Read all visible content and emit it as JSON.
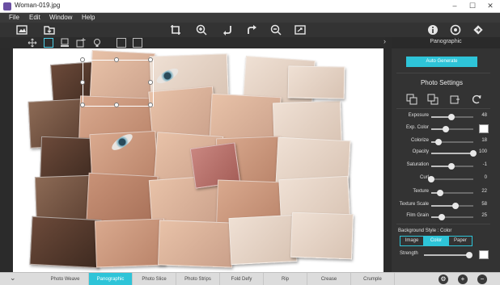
{
  "window": {
    "title": "Woman-019.jpg",
    "minimize": "–",
    "maximize": "☐",
    "close": "✕"
  },
  "menu": [
    "File",
    "Edit",
    "Window",
    "Help"
  ],
  "toolbar": {
    "icons": [
      "image-icon",
      "open-icon",
      "crop-icon",
      "zoom-in-icon",
      "rotate-left-icon",
      "rotate-right-icon",
      "zoom-out-icon",
      "fit-icon",
      "info-icon",
      "settings-icon",
      "share-icon"
    ]
  },
  "toolbar2": {
    "icons": [
      "move-icon",
      "select-icon",
      "stamp-icon",
      "add-tile-icon",
      "light-icon",
      "image-thumb-icon",
      "settings-small-icon"
    ]
  },
  "panel": {
    "header": "Panographic",
    "collapse_glyph": "›",
    "auto_generate": "Auto Generate",
    "section_title": "Photo Settings",
    "controls": [
      {
        "label": "Exposure",
        "value": "48",
        "fraction": 0.48
      },
      {
        "label": "Exp. Color",
        "swatch": "#ffffff",
        "fraction": 0.35
      },
      {
        "label": "Colorize",
        "value": "18",
        "fraction": 0.18
      },
      {
        "label": "Opacity",
        "value": "100",
        "fraction": 1.0
      },
      {
        "label": "Saturation",
        "value": "-1",
        "fraction": 0.49
      },
      {
        "label": "Curl",
        "value": "0",
        "fraction": 0.0
      },
      {
        "label": "Texture",
        "value": "22",
        "fraction": 0.22
      },
      {
        "label": "Texture Scale",
        "value": "58",
        "fraction": 0.58
      },
      {
        "label": "Film Grain",
        "value": "25",
        "fraction": 0.25
      }
    ],
    "background_style_label": "Background Style : Color",
    "background_options": [
      "Image",
      "Color",
      "Paper"
    ],
    "background_active": "Color",
    "strength_label": "Strength",
    "strength_fraction": 0.97,
    "strength_swatch": "#ffffff"
  },
  "tabs": {
    "items": [
      "Photo Weave",
      "Panographic",
      "Photo Slice",
      "Photo Strips",
      "Fold Defy",
      "Rip",
      "Crease",
      "Crumple"
    ],
    "active": "Panographic",
    "right_icons": [
      "settings-round-icon",
      "add-icon",
      "remove-icon"
    ]
  },
  "colors": {
    "accent": "#2ec4d8",
    "panel": "#333333",
    "toolbar": "#333333",
    "canvas": "#ffffff"
  }
}
